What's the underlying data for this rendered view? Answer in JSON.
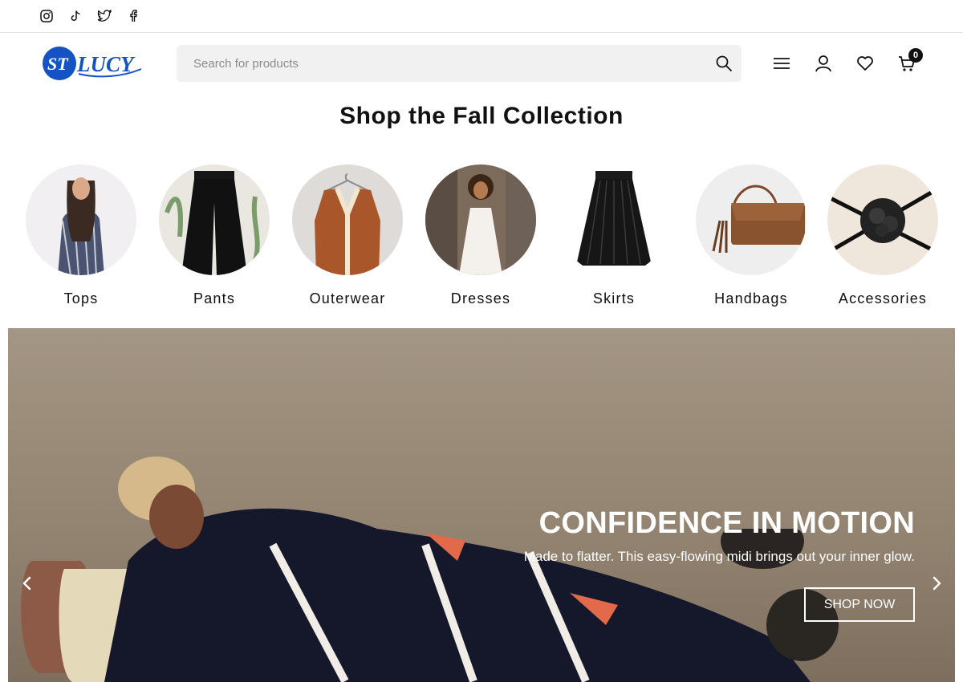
{
  "topbar": {
    "social": [
      {
        "name": "instagram-icon"
      },
      {
        "name": "tiktok-icon"
      },
      {
        "name": "twitter-icon"
      },
      {
        "name": "facebook-icon"
      }
    ]
  },
  "header": {
    "logo_text": "ST LUCY",
    "logo_color": "#1453c4",
    "search": {
      "placeholder": "Search for products"
    },
    "icons": [
      "menu-icon",
      "account-icon",
      "wishlist-icon",
      "cart-icon"
    ],
    "cart_count": "0"
  },
  "collection": {
    "title": "Shop the Fall Collection",
    "categories": [
      {
        "label": "Tops"
      },
      {
        "label": "Pants"
      },
      {
        "label": "Outerwear"
      },
      {
        "label": "Dresses"
      },
      {
        "label": "Skirts"
      },
      {
        "label": "Handbags"
      },
      {
        "label": "Accessories"
      }
    ]
  },
  "banner": {
    "headline": "CONFIDENCE IN MOTION",
    "subtext": "Made to flatter. This easy-flowing midi brings out your inner glow.",
    "button_label": "SHOP NOW",
    "prev_icon": "chevron-left-icon",
    "next_icon": "chevron-right-icon"
  },
  "colors": {
    "brand": "#1453c4",
    "text": "#111111",
    "search_bg": "#f1f1f1",
    "banner_bg": "#9a8a76"
  }
}
